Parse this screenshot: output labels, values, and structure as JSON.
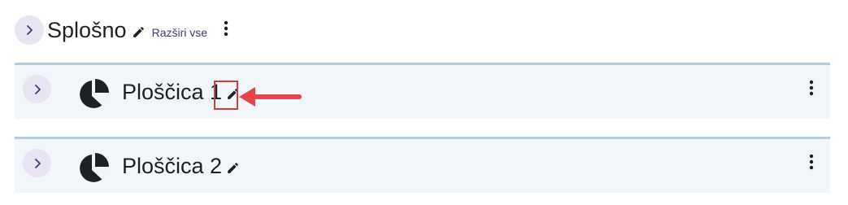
{
  "section": {
    "title": "Splošno",
    "expand_all": "Razširi vse",
    "toggle_icon": "chevron-right-icon",
    "edit_icon": "pencil-icon",
    "menu_icon": "kebab-menu-icon"
  },
  "activities": [
    {
      "title": "Ploščica 1",
      "icon": "pie-chart-icon",
      "highlighted": true
    },
    {
      "title": "Ploščica 2",
      "icon": "pie-chart-icon",
      "highlighted": false
    }
  ],
  "annotation": {
    "color": "#e8424a",
    "box_color": "#d93a3a"
  },
  "colors": {
    "toggle_bg": "#e8e4f1",
    "activity_bg": "#f1f6fa",
    "activity_border": "#b3cce0",
    "link": "#3f3a7a"
  }
}
